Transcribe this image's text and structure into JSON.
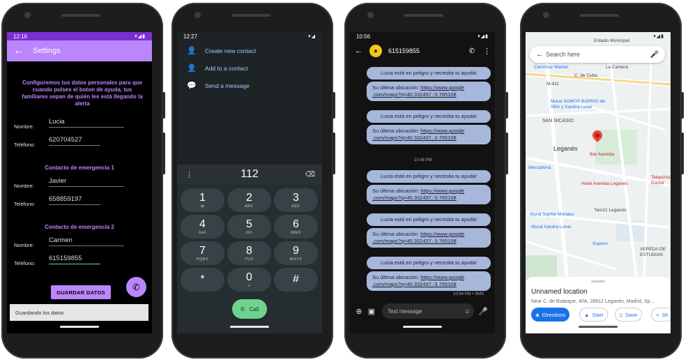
{
  "phone1": {
    "status": {
      "time": "12:16",
      "icons": "▾◢▮"
    },
    "appbar": {
      "back": "←",
      "title": "Settings"
    },
    "intro": "Configuremos tus datos personales para que cuando pulses el boton de ayuda, tus familiares sepan de quién les está llegando la alerta",
    "fields": {
      "nombre_label": "Nombre:",
      "nombre_value": "Lucia",
      "telefono_label": "Teléfono:",
      "telefono_value": "620704527"
    },
    "contact1": {
      "heading": "Contacto de emergencia 1",
      "nombre_label": "Nombre:",
      "nombre_value": "Javier",
      "telefono_label": "Teléfono:",
      "telefono_value": "658859197"
    },
    "contact2": {
      "heading": "Contacto de emergencia 2",
      "nombre_label": "Nombre:",
      "nombre_value": "Carmen",
      "telefono_label": "Teléfono:",
      "telefono_value": "615159855"
    },
    "save_button": "GUARDAR DATOS",
    "fab_icon": "✆",
    "toast": "Guardando los datos"
  },
  "phone2": {
    "status": {
      "time": "12:27",
      "icons": "▾◢"
    },
    "menu": [
      {
        "icon": "👤",
        "label": "Create new contact"
      },
      {
        "icon": "👤",
        "label": "Add to a contact"
      },
      {
        "icon": "💬",
        "label": "Send a message"
      }
    ],
    "number": "112",
    "more": "⋮",
    "delete": "⌫",
    "keys": [
      {
        "d": "1",
        "l": "ꝏ"
      },
      {
        "d": "2",
        "l": "ABC"
      },
      {
        "d": "3",
        "l": "DEF"
      },
      {
        "d": "4",
        "l": "GHI"
      },
      {
        "d": "5",
        "l": "JKL"
      },
      {
        "d": "6",
        "l": "MNO"
      },
      {
        "d": "7",
        "l": "PQRS"
      },
      {
        "d": "8",
        "l": "TUV"
      },
      {
        "d": "9",
        "l": "WXYZ"
      },
      {
        "d": "*",
        "l": ""
      },
      {
        "d": "0",
        "l": "+"
      },
      {
        "d": "#",
        "l": ""
      }
    ],
    "call_label": "Call",
    "call_icon": "✆"
  },
  "phone3": {
    "status": {
      "time": "10:56",
      "icons": "▾◢▮"
    },
    "contact_name": "615159855",
    "back": "←",
    "call_icon": "✆",
    "more": "⋮",
    "msg_danger": "Lucia está en peligro y necesita tu ayuda!",
    "msg_loc_prefix": "Su última ubicación: ",
    "msg_loc_link1": "https://www.google",
    "msg_loc_link2": ".com/maps?q=40.332437,-3.765108",
    "time_sep": "10:48 PM",
    "last_meta": "10:54 PM • SMS",
    "composer_placeholder": "Text message",
    "composer_icons": {
      "add": "⊕",
      "gallery": "▣",
      "emoji": "☺",
      "mic": "🎤"
    }
  },
  "phone4": {
    "status": {
      "time": "",
      "icons": "▾◢▮"
    },
    "search_placeholder": "Search here",
    "back": "←",
    "mic": "🎤",
    "labels": [
      {
        "t": "Estadio Municipal",
        "cls": ""
      },
      {
        "t": "Carrefour Market",
        "cls": "blue"
      },
      {
        "t": "La Cantera",
        "cls": ""
      },
      {
        "t": "C. de Cuba",
        "cls": ""
      },
      {
        "t": "M-411",
        "cls": ""
      },
      {
        "t": "Mural SOMOS BARRIO de Sfhir y Xandra Lunar",
        "cls": "blue"
      },
      {
        "t": "SAN NICASIO",
        "cls": ""
      },
      {
        "t": "Leganés",
        "cls": "big"
      },
      {
        "t": "Bar Avenida",
        "cls": "red"
      },
      {
        "t": "Mercadona",
        "cls": "blue"
      },
      {
        "t": "Hotel Avenida Leganés",
        "cls": "red"
      },
      {
        "t": "Telepizza Doctor",
        "cls": "red"
      },
      {
        "t": "Mural Sophie Morales",
        "cls": "blue"
      },
      {
        "t": "Mural Xandra Lunar",
        "cls": "blue"
      },
      {
        "t": "Tien21 Leganés",
        "cls": ""
      },
      {
        "t": "Supeco",
        "cls": "blue"
      },
      {
        "t": "VEREDA DE ESTUDIAN",
        "cls": ""
      }
    ],
    "place_title": "Unnamed location",
    "place_address": "Near C. de Butarque, 40A, 28912 Leganés, Madrid, Sp...",
    "actions": [
      {
        "icon": "◈",
        "label": "Directions",
        "primary": true
      },
      {
        "icon": "▲",
        "label": "Start",
        "primary": false
      },
      {
        "icon": "▯",
        "label": "Save",
        "primary": false
      },
      {
        "icon": "<",
        "label": "Sh",
        "primary": false
      }
    ]
  }
}
